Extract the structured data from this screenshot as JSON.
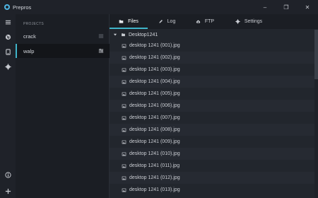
{
  "app": {
    "title": "Prepros"
  },
  "window_controls": {
    "minimize": "–",
    "maximize": "❐",
    "close": "✕"
  },
  "rail": [
    "menu-icon",
    "globe-icon",
    "device-icon",
    "gear-icon",
    "info-icon",
    "plus-icon"
  ],
  "projects": {
    "heading": "PROJECTS",
    "items": [
      {
        "name": "crack",
        "active": false
      },
      {
        "name": "walp",
        "active": true
      }
    ]
  },
  "tabs": [
    {
      "label": "Files",
      "icon": "folder-icon",
      "active": true
    },
    {
      "label": "Log",
      "icon": "pen-icon",
      "active": false
    },
    {
      "label": "FTP",
      "icon": "cloud-upload-icon",
      "active": false
    },
    {
      "label": "Settings",
      "icon": "gear-icon",
      "active": false
    }
  ],
  "tree": {
    "root": "Desktop1241",
    "files": [
      "desktop 1241 (001).jpg",
      "desktop 1241 (002).jpg",
      "desktop 1241 (003).jpg",
      "desktop 1241 (004).jpg",
      "desktop 1241 (005).jpg",
      "desktop 1241 (006).jpg",
      "desktop 1241 (007).jpg",
      "desktop 1241 (008).jpg",
      "desktop 1241 (009).jpg",
      "desktop 1241 (010).jpg",
      "desktop 1241 (011).jpg",
      "desktop 1241 (012).jpg",
      "desktop 1241 (013).jpg"
    ]
  },
  "colors": {
    "accent": "#3fb4c9",
    "logo": "#4fb7e5",
    "background": "#1b1e24"
  }
}
